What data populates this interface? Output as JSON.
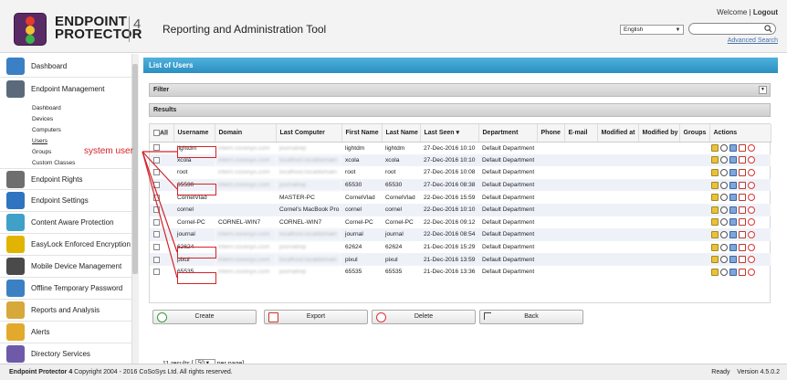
{
  "header": {
    "logo_line1": "ENDPOINT",
    "logo_line2": "PROTECTOR",
    "logo_version": "4",
    "app_title": "Reporting and Administration Tool",
    "welcome": "Welcome",
    "separator": "|",
    "logout": "Logout",
    "language": "English",
    "search_value": "",
    "advanced_search": "Advanced Search"
  },
  "sidebar": {
    "items": [
      {
        "label": "Dashboard",
        "icon": "dashboard-icon",
        "color": "#3b7fc4"
      },
      {
        "label": "Endpoint Management",
        "icon": "computer-icon",
        "color": "#5a6a7a"
      },
      {
        "label": "Endpoint Rights",
        "icon": "gears-icon",
        "color": "#6e6e6e"
      },
      {
        "label": "Endpoint Settings",
        "icon": "tools-icon",
        "color": "#2f74c0"
      },
      {
        "label": "Content Aware Protection",
        "icon": "shield-icon",
        "color": "#3fa0c8"
      },
      {
        "label": "EasyLock Enforced Encryption",
        "icon": "lock-icon",
        "color": "#e0b400"
      },
      {
        "label": "Mobile Device Management",
        "icon": "mobile-icon",
        "color": "#4a4a4a"
      },
      {
        "label": "Offline Temporary Password",
        "icon": "password-icon",
        "color": "#3c80c4"
      },
      {
        "label": "Reports and Analysis",
        "icon": "chart-icon",
        "color": "#d7a83a"
      },
      {
        "label": "Alerts",
        "icon": "alert-icon",
        "color": "#e2a92c"
      },
      {
        "label": "Directory Services",
        "icon": "directory-icon",
        "color": "#6e5aa8"
      }
    ],
    "sub_items": [
      "Dashboard",
      "Devices",
      "Computers",
      "Users",
      "Groups",
      "Custom Classes"
    ]
  },
  "main": {
    "list_title": "List of Users",
    "filter_label": "Filter",
    "results_label": "Results",
    "columns": [
      "All",
      "Username",
      "Domain",
      "Last Computer",
      "First Name",
      "Last Name",
      "Last Seen ▾",
      "Department",
      "Phone",
      "E-mail",
      "Modified at",
      "Modified by",
      "Groups",
      "Actions"
    ],
    "rows": [
      [
        "lightdm",
        "intern.cosesys.com",
        "journalrep",
        "lightdm",
        "lightdm",
        "27-Dec-2016 10:10",
        "Default Department"
      ],
      [
        "xcola",
        "intern.cosesys.com",
        "localhost.localdomain",
        "xcola",
        "xcola",
        "27-Dec-2016 10:10",
        "Default Department"
      ],
      [
        "root",
        "intern.cosesys.com",
        "localhost.localdomain",
        "root",
        "root",
        "27-Dec-2016 10:08",
        "Default Department"
      ],
      [
        "65530",
        "intern.cosesys.com",
        "journalrep",
        "65530",
        "65530",
        "27-Dec-2016 08:38",
        "Default Department"
      ],
      [
        "CornelVlad",
        "",
        "MASTER-PC",
        "CornelVlad",
        "CornelVlad",
        "22-Dec-2016 15:59",
        "Default Department"
      ],
      [
        "cornel",
        "",
        "Cornel's MacBook Pro",
        "cornel",
        "cornel",
        "22-Dec-2016 10:10",
        "Default Department"
      ],
      [
        "Cornel-PC",
        "CORNEL-WIN7",
        "CORNEL-WIN7",
        "Cornel-PC",
        "Cornel-PC",
        "22-Dec-2016 09:12",
        "Default Department"
      ],
      [
        "journal",
        "intern.cosesys.com",
        "localhost.localdomain",
        "journal",
        "journal",
        "22-Dec-2016 08:54",
        "Default Department"
      ],
      [
        "62624",
        "intern.cosesys.com",
        "journalrep",
        "62624",
        "62624",
        "21-Dec-2016 15:29",
        "Default Department"
      ],
      [
        "pixul",
        "intern.cosesys.com",
        "localhost.localdomain",
        "pixul",
        "pixul",
        "21-Dec-2016 13:59",
        "Default Department"
      ],
      [
        "65535",
        "intern.cosesys.com",
        "journalrep",
        "65535",
        "65535",
        "21-Dec-2016 13:36",
        "Default Department"
      ]
    ],
    "blurred_domain_rows": [
      0,
      1,
      2,
      3,
      7,
      8,
      9,
      10
    ],
    "blurred_computer_rows": [
      0,
      1,
      2,
      3,
      7,
      8,
      9,
      10
    ],
    "results_count": "11 results",
    "per_page_open": "[",
    "per_page_value": "50",
    "per_page_close": "per page]",
    "buttons": {
      "create": "Create",
      "export": "Export",
      "delete": "Delete",
      "back": "Back"
    }
  },
  "annotation": {
    "label": "system user",
    "color": "#d4232a"
  },
  "footer": {
    "product": "Endpoint Protector 4",
    "copyright": " Copyright 2004 - 2016 CoSoSys Ltd. All rights reserved.",
    "status": "Ready",
    "version": "Version 4.5.0.2"
  }
}
